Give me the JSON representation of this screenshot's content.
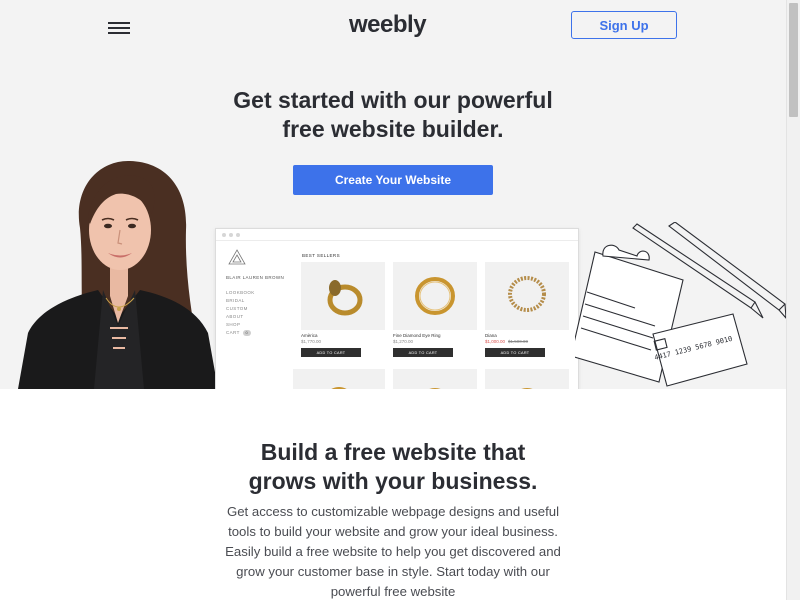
{
  "header": {
    "logo": "weebly",
    "signup_label": "Sign Up",
    "menu_icon": "hamburger-menu-icon"
  },
  "hero": {
    "title_line1": "Get started with our powerful",
    "title_line2": "free website builder.",
    "cta_label": "Create Your Website"
  },
  "mockup": {
    "brand": "BLAIR LAUREN BROWN",
    "nav": [
      "LOOKBOOK",
      "BRIDAL",
      "CUSTOM",
      "ABOUT",
      "SHOP",
      "CART"
    ],
    "cart_count": "0",
    "section_title": "BEST SELLERS",
    "products": [
      {
        "name": "Amèrica",
        "price": "$1,770.00",
        "old_price": "",
        "button": "ADD TO CART"
      },
      {
        "name": "Fine Diamond Eye Ring",
        "price": "$1,270.00",
        "old_price": "",
        "button": "ADD TO CART"
      },
      {
        "name": "Diana",
        "price": "$1,000.00",
        "old_price": "$1,500.00",
        "button": "ADD TO CART"
      }
    ]
  },
  "section2": {
    "title_line1": "Build a free website that",
    "title_line2": "grows with your business.",
    "body": "Get access to customizable webpage designs and useful tools to build your website and grow your ideal business. Easily build a free website to help you get discovered and grow your customer base in style. Start today with our powerful free website"
  },
  "colors": {
    "accent": "#3d72ea",
    "text": "#2b2d33",
    "hero_bg": "#f3f3f3"
  }
}
